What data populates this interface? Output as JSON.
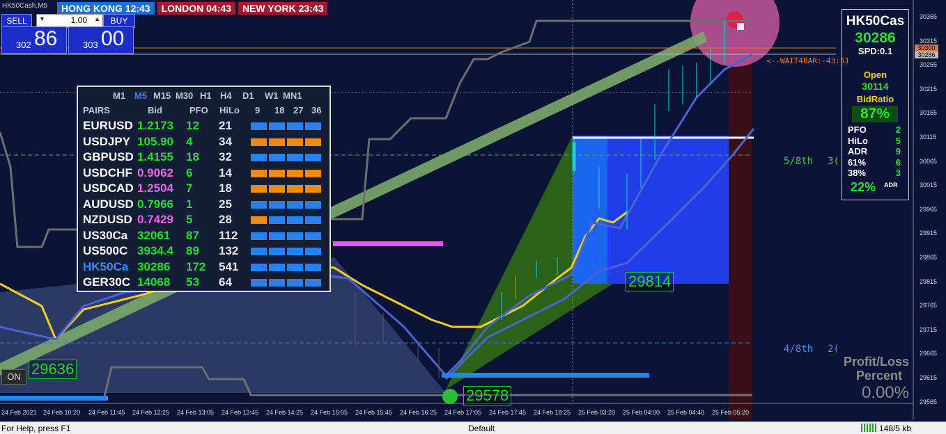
{
  "window": {
    "symbol": "HK50Cash,M5"
  },
  "sessions": [
    {
      "label": "HONG KONG 12:43",
      "color": "#1f6fd1"
    },
    {
      "label": "LONDON  04:43",
      "color": "#9c1f2c"
    },
    {
      "label": "NEW YORK  23:43",
      "color": "#9c1f2c"
    }
  ],
  "trade_panel": {
    "sell_label": "SELL",
    "buy_label": "BUY",
    "lot_value": "1.00",
    "sell_small": "302",
    "sell_big": "86",
    "buy_small": "303",
    "buy_big": "00"
  },
  "scanner": {
    "timeframes": [
      "M1",
      "M5",
      "M15",
      "M30",
      "H1",
      "H4",
      "D1",
      "W1",
      "MN1"
    ],
    "active_tf": "M5",
    "headers": {
      "pairs": "PAIRS",
      "bid": "Bid",
      "pfo": "PFO",
      "hilo": "HiLo",
      "c9": "9",
      "c18": "18",
      "c27": "27",
      "c36": "36"
    },
    "rows": [
      {
        "pair": "EURUSD",
        "bid": "1.2173",
        "pfo": "12",
        "hilo": "21",
        "bid_color": "#22e022",
        "pair_color": "#ffffff",
        "squares": [
          "#2a80ee",
          "#2a80ee",
          "#2a80ee",
          "#2a80ee"
        ]
      },
      {
        "pair": "USDJPY",
        "bid": "105.90",
        "pfo": "4",
        "hilo": "34",
        "bid_color": "#22e022",
        "pair_color": "#ffffff",
        "squares": [
          "#f08a10",
          "#f08a10",
          "#f08a10",
          "#f08a10"
        ]
      },
      {
        "pair": "GBPUSD",
        "bid": "1.4155",
        "pfo": "18",
        "hilo": "32",
        "bid_color": "#22e022",
        "pair_color": "#ffffff",
        "squares": [
          "#2a80ee",
          "#2a80ee",
          "#2a80ee",
          "#2a80ee"
        ]
      },
      {
        "pair": "USDCHF",
        "bid": "0.9062",
        "pfo": "6",
        "hilo": "14",
        "bid_color": "#ee66ee",
        "pair_color": "#ffffff",
        "squares": [
          "#f08a10",
          "#f08a10",
          "#f08a10",
          "#f08a10"
        ]
      },
      {
        "pair": "USDCAD",
        "bid": "1.2504",
        "pfo": "7",
        "hilo": "18",
        "bid_color": "#ee66ee",
        "pair_color": "#ffffff",
        "squares": [
          "#f08a10",
          "#f08a10",
          "#f08a10",
          "#f08a10"
        ]
      },
      {
        "pair": "AUDUSD",
        "bid": "0.7966",
        "pfo": "1",
        "hilo": "25",
        "bid_color": "#22e022",
        "pair_color": "#ffffff",
        "squares": [
          "#2a80ee",
          "#2a80ee",
          "#2a80ee",
          "#2a80ee"
        ]
      },
      {
        "pair": "NZDUSD",
        "bid": "0.7429",
        "pfo": "5",
        "hilo": "28",
        "bid_color": "#ee66ee",
        "pair_color": "#ffffff",
        "squares": [
          "#f08a10",
          "#2a80ee",
          "#2a80ee",
          "#2a80ee"
        ]
      },
      {
        "pair": "US30Ca",
        "bid": "32061",
        "pfo": "87",
        "hilo": "112",
        "bid_color": "#22e022",
        "pair_color": "#ffffff",
        "squares": [
          "#2a80ee",
          "#2a80ee",
          "#2a80ee",
          "#2a80ee"
        ]
      },
      {
        "pair": "US500C",
        "bid": "3934.4",
        "pfo": "89",
        "hilo": "132",
        "bid_color": "#22e022",
        "pair_color": "#ffffff",
        "squares": [
          "#2a80ee",
          "#2a80ee",
          "#2a80ee",
          "#2a80ee"
        ]
      },
      {
        "pair": "HK50Ca",
        "bid": "30286",
        "pfo": "172",
        "hilo": "541",
        "bid_color": "#22e022",
        "pair_color": "#3a8cff",
        "squares": [
          "#2a80ee",
          "#2a80ee",
          "#2a80ee",
          "#2a80ee"
        ]
      },
      {
        "pair": "GER30C",
        "bid": "14068",
        "pfo": "53",
        "hilo": "64",
        "bid_color": "#22e022",
        "pair_color": "#ffffff",
        "squares": [
          "#2a80ee",
          "#2a80ee",
          "#2a80ee",
          "#2a80ee"
        ]
      }
    ]
  },
  "info_panel": {
    "symbol": "HK50Cas",
    "price": "30286",
    "spread": "SPD:0.1",
    "open_label": "Open",
    "open_value": "30114",
    "bidratio_label": "BidRatio",
    "bidratio_value": "87%",
    "stats": [
      {
        "label": "PFO",
        "value": "2"
      },
      {
        "label": "HiLo",
        "value": "5"
      },
      {
        "label": "ADR",
        "value": "9"
      },
      {
        "label": "61%",
        "value": "6"
      },
      {
        "label": "38%",
        "value": "3"
      }
    ],
    "adr_pct": "22%",
    "adr_suffix": "ADR"
  },
  "chart_labels": {
    "wait": "<--WAIT4BAR:-43:51",
    "fib_5_8": "5/8th",
    "fib_5_8_cut": "3(",
    "fib_4_8": "4/8th",
    "fib_4_8_cut": "2(",
    "profit_loss": "Profit/Loss",
    "percent": "Percent",
    "pl_value": "0.00%",
    "on_label": "ON",
    "level_29636": "29636",
    "level_29578": "29578",
    "level_29814": "29814"
  },
  "price_axis": {
    "labels": [
      "30365",
      "30315",
      "30265",
      "30215",
      "30165",
      "30115",
      "30065",
      "30015",
      "29965",
      "29915",
      "29865",
      "29815",
      "29765",
      "29715",
      "29665",
      "29615",
      "29565"
    ],
    "tag_orange": "30300",
    "tag_gray": "30286"
  },
  "time_axis": [
    "24 Feb 2021",
    "24 Feb 10:20",
    "24 Feb 11:45",
    "24 Feb 12:25",
    "24 Feb 13:05",
    "24 Feb 13:45",
    "24 Feb 14:25",
    "24 Feb 15:05",
    "24 Feb 15:45",
    "24 Feb 16:25",
    "24 Feb 17:05",
    "24 Feb 17:45",
    "24 Feb 18:25",
    "25 Feb 03:20",
    "25 Feb 04:00",
    "25 Feb 04:40",
    "25 Feb 05:20"
  ],
  "status_bar": {
    "help": "For Help, press F1",
    "profile": "Default",
    "traffic": "148/5 kb"
  }
}
